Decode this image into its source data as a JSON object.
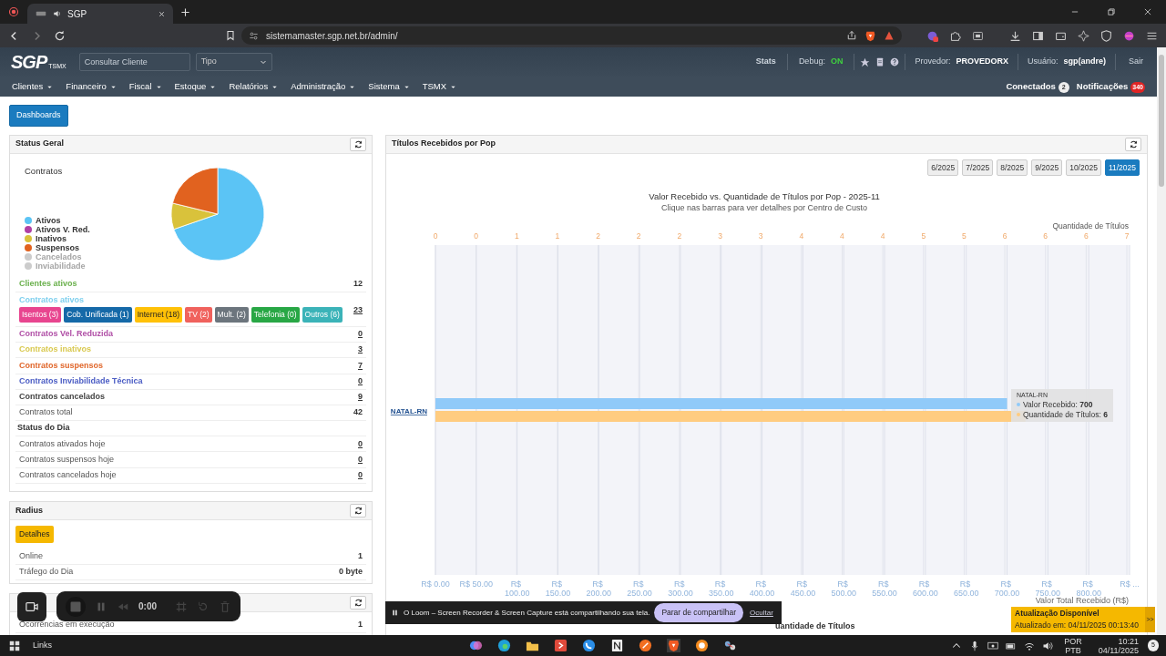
{
  "browser": {
    "tab_title": "SGP",
    "url": "sistemamaster.sgp.net.br/admin/"
  },
  "app_header": {
    "logo": "SGP",
    "logo_sub": "TSMX",
    "search": {
      "placeholder": "Consultar Cliente"
    },
    "type_select": "Tipo",
    "stats": "Stats",
    "debug_label": "Debug:",
    "debug_value": "ON",
    "provider_label": "Provedor:",
    "provider": "PROVEDORX",
    "user_label": "Usuário:",
    "user": "sgp(andre)",
    "logout": "Sair"
  },
  "menu": [
    "Clientes",
    "Financeiro",
    "Fiscal",
    "Estoque",
    "Relatórios",
    "Administração",
    "Sistema",
    "TSMX"
  ],
  "connections": {
    "label": "Conectados",
    "count": "2"
  },
  "notifications": {
    "label": "Notificações",
    "count": "340"
  },
  "dashboards_button": "Dashboards",
  "status_panel": {
    "title": "Status Geral",
    "chart_title": "Contratos",
    "legend": [
      {
        "label": "Ativos",
        "color": "#5bc4f5",
        "hidden": false
      },
      {
        "label": "Ativos V. Red.",
        "color": "#b03fa4",
        "hidden": false
      },
      {
        "label": "Inativos",
        "color": "#d9c23b",
        "hidden": false
      },
      {
        "label": "Suspensos",
        "color": "#e1621f",
        "hidden": false
      },
      {
        "label": "Cancelados",
        "color": "#cccccc",
        "hidden": true
      },
      {
        "label": "Inviabilidade",
        "color": "#cccccc",
        "hidden": true
      }
    ],
    "rows": [
      {
        "kind": "stat",
        "label": "Clientes ativos",
        "value": "12",
        "color": "#6ab04c",
        "link": false,
        "strong": true
      },
      {
        "kind": "badges",
        "label": "Contratos ativos",
        "value": "23",
        "color": "#7fd0ee",
        "link": true,
        "strong": true,
        "badges": [
          {
            "label": "Isentos (3)",
            "color": "#e8458f"
          },
          {
            "label": "Cob. Unificada (1)",
            "color": "#1569a8"
          },
          {
            "label": "Internet (18)",
            "color": "#ffc107"
          },
          {
            "label": "TV (2)",
            "color": "#f0625d"
          },
          {
            "label": "Mult. (2)",
            "color": "#6c757d"
          },
          {
            "label": "Telefonia (0)",
            "color": "#28a745"
          },
          {
            "label": "Outros (6)",
            "color": "#3bb3b8"
          }
        ]
      },
      {
        "kind": "stat",
        "label": "Contratos Vel. Reduzida",
        "value": "0",
        "color": "#b04fa6",
        "link": true,
        "strong": true
      },
      {
        "kind": "stat",
        "label": "Contratos inativos",
        "value": "3",
        "color": "#d9c94f",
        "link": true,
        "strong": true
      },
      {
        "kind": "stat",
        "label": "Contratos suspensos",
        "value": "7",
        "color": "#e0662a",
        "link": true,
        "strong": true
      },
      {
        "kind": "stat",
        "label": "Contratos Inviabilidade Técnica",
        "value": "0",
        "color": "#4a5cc4",
        "link": true,
        "strong": true
      },
      {
        "kind": "stat",
        "label": "Contratos cancelados",
        "value": "9",
        "color": "#444444",
        "link": true,
        "strong": true
      },
      {
        "kind": "stat",
        "label": "Contratos total",
        "value": "42",
        "link": false,
        "strong": false
      },
      {
        "kind": "heading",
        "label": "Status do Dia"
      },
      {
        "kind": "stat",
        "label": "Contratos ativados hoje",
        "value": "0",
        "link": true,
        "strong": false
      },
      {
        "kind": "stat",
        "label": "Contratos suspensos hoje",
        "value": "0",
        "link": true,
        "strong": false
      },
      {
        "kind": "stat",
        "label": "Contratos cancelados hoje",
        "value": "0",
        "link": true,
        "strong": false
      }
    ]
  },
  "radius_panel": {
    "title": "Radius",
    "details_button": "Detalhes",
    "rows": [
      {
        "label": "Online",
        "value": "1"
      },
      {
        "label": "Tráfego do Dia",
        "value": "0 byte"
      }
    ]
  },
  "events_panel": {
    "rows": [
      {
        "label": "Ocorrências em execução",
        "value": "1"
      }
    ]
  },
  "pop_panel": {
    "title": "Títulos Recebidos por Pop",
    "months": [
      {
        "label": "6/2025",
        "selected": false
      },
      {
        "label": "7/2025",
        "selected": false
      },
      {
        "label": "8/2025",
        "selected": false
      },
      {
        "label": "9/2025",
        "selected": false
      },
      {
        "label": "10/2025",
        "selected": false
      },
      {
        "label": "11/2025",
        "selected": true
      }
    ],
    "subtitle": "Clique nas barras para ver detalhes por Centro de Custo",
    "secondary_axis": {
      "title": "Quantidade de Títulos",
      "ticks": [
        "0",
        "0",
        "1",
        "1",
        "2",
        "2",
        "2",
        "3",
        "3",
        "4",
        "4",
        "4",
        "5",
        "5",
        "6",
        "6",
        "6",
        "7"
      ]
    },
    "chart_title": "Valor Recebido vs. Quantidade de Títulos por Pop - 2025-11",
    "category": "NATAL-RN",
    "series": [
      {
        "name": "Valor Recebido",
        "color": "#90caf9"
      },
      {
        "name": "Quantidade de Títulos",
        "color": "#ffcc80"
      }
    ],
    "value_axis": {
      "title": "Valor Total Recebido (R$)",
      "ticks": [
        "R$ 0.00",
        "R$ 50.00",
        "R$ 100.00",
        "R$ 150.00",
        "R$ 200.00",
        "R$ 250.00",
        "R$ 300.00",
        "R$ 350.00",
        "R$ 400.00",
        "R$ 450.00",
        "R$ 500.00",
        "R$ 550.00",
        "R$ 600.00",
        "R$ 650.00",
        "R$ 700.00",
        "R$ 750.00",
        "R$ 800.00",
        "R$ ..."
      ]
    },
    "tooltip": {
      "title": "NATAL-RN",
      "values": [
        ": **700**",
        ": **6**"
      ]
    },
    "legend_label": "uantidade de Títulos"
  },
  "loom_controls": {
    "timer": "0:00"
  },
  "loom_bar": {
    "message": "O Loom – Screen Recorder & Screen Capture está compartilhando sua tela.",
    "stop_button": "Parar de compartilhar",
    "hide_link": "Ocultar"
  },
  "update_toast": {
    "title": "Atualização Disponível",
    "text": "Atualizado em: 04/11/2025 00:13:40",
    "expand": ">>"
  },
  "taskbar": {
    "links": "Links",
    "lang": "POR",
    "layout": "PTB",
    "time": "10:21",
    "date": "04/11/2025",
    "notifications": "5"
  }
}
